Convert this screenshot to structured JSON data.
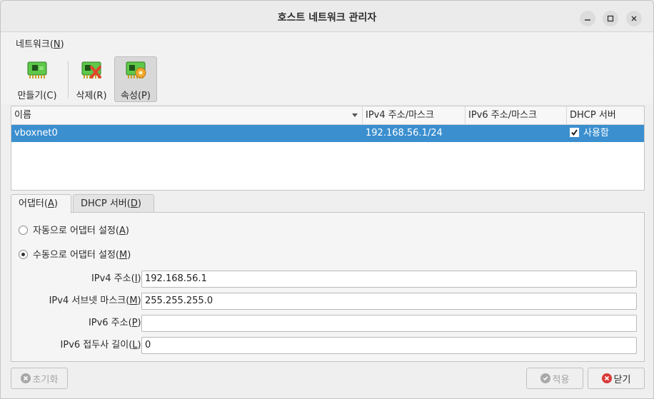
{
  "window": {
    "title": "호스트 네트워크 관리자",
    "controls": [
      "minimize-icon",
      "maximize-icon",
      "close-icon"
    ]
  },
  "menubar": {
    "network_prefix": "네트워크(",
    "network_mnemonic": "N",
    "network_suffix": ")"
  },
  "toolbar": {
    "create_label": "만들기(C)",
    "delete_label": "삭제(R)",
    "properties_label": "속성(P)"
  },
  "table": {
    "columns": [
      "이름",
      "IPv4 주소/마스크",
      "IPv6 주소/마스크",
      "DHCP 서버"
    ],
    "rows": [
      {
        "name": "vboxnet0",
        "ipv4": "192.168.56.1/24",
        "ipv6": "",
        "dhcp": "사용함",
        "dhcp_checked": true
      }
    ]
  },
  "tabs": {
    "adapter": {
      "prefix": "어댑터(",
      "mnemonic": "A",
      "suffix": ")"
    },
    "dhcp": {
      "prefix": "DHCP 서버(",
      "mnemonic": "D",
      "suffix": ")"
    }
  },
  "adapter": {
    "auto_radio": {
      "prefix": "자동으로 어댑터 설정(",
      "mnemonic": "A",
      "suffix": ")"
    },
    "manual_radio": {
      "prefix": "수동으로 어댑터 설정(",
      "mnemonic": "M",
      "suffix": ")"
    },
    "ipv4_label": {
      "prefix": "IPv4 주소(",
      "mnemonic": "I",
      "suffix": "):"
    },
    "ipv4_value": "192.168.56.1",
    "mask_label": {
      "prefix": "IPv4 서브넷 마스크(",
      "mnemonic": "M",
      "suffix": "):"
    },
    "mask_value": "255.255.255.0",
    "ipv6_label": {
      "prefix": "IPv6 주소(",
      "mnemonic": "P",
      "suffix": "):"
    },
    "ipv6_value": "",
    "prefix_label": {
      "prefix": "IPv6 접두사 길이(",
      "mnemonic": "L",
      "suffix": "):"
    },
    "prefix_value": "0"
  },
  "buttons": {
    "reset_label": "초기화",
    "apply_label": "적용",
    "close_label": "닫기"
  },
  "colors": {
    "selection": "#3b8fcf",
    "close_icon": "#d93a3a",
    "disabled_icon": "#a8a8a8"
  }
}
